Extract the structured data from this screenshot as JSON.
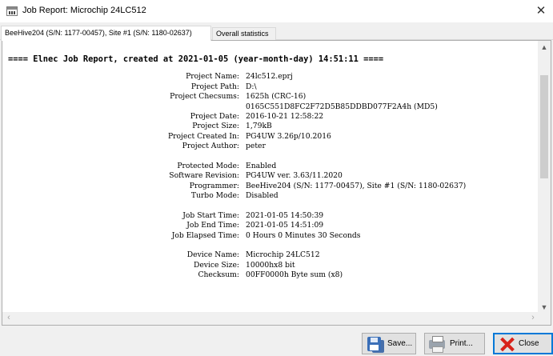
{
  "window": {
    "title": "Job Report: Microchip  24LC512",
    "app_icon": "elnec-app-icon",
    "close_glyph": "✕"
  },
  "tabs": [
    {
      "label": "BeeHive204 (S/N: 1177-00457), Site #1 (S/N: 1180-02637)",
      "active": true
    },
    {
      "label": "Overall statistics",
      "active": false
    }
  ],
  "report": {
    "title": "==== Elnec Job Report, created at 2021-01-05 (year-month-day)  14:51:11 ====",
    "project_section": [
      {
        "label": "Project Name:",
        "value": "24lc512.eprj"
      },
      {
        "label": "Project Path:",
        "value": "D:\\"
      },
      {
        "label": "Project Checsums:",
        "value": "1625h (CRC-16)"
      },
      {
        "label": "",
        "value": "0165C551D8FC2F72D5B85DDBD077F2A4h (MD5)"
      },
      {
        "label": "Project Date:",
        "value": "2016-10-21  12:58:22"
      },
      {
        "label": "Project Size:",
        "value": "1,79kB"
      },
      {
        "label": "Project Created In:",
        "value": "PG4UW 3.26p/10.2016"
      },
      {
        "label": "Project Author:",
        "value": "peter"
      }
    ],
    "mode_section": [
      {
        "label": "Protected Mode:",
        "value": "Enabled"
      },
      {
        "label": "Software Revision:",
        "value": "PG4UW ver. 3.63/11.2020"
      },
      {
        "label": "Programmer:",
        "value": "BeeHive204 (S/N: 1177-00457), Site #1 (S/N: 1180-02637)"
      },
      {
        "label": "Turbo Mode:",
        "value": "Disabled"
      }
    ],
    "time_section": [
      {
        "label": "Job Start Time:",
        "value": "2021-01-05  14:50:39"
      },
      {
        "label": "Job End Time:",
        "value": "2021-01-05  14:51:09"
      },
      {
        "label": "Job Elapsed Time:",
        "value": "0 Hours 0 Minutes 30 Seconds"
      }
    ],
    "device_section": [
      {
        "label": "Device Name:",
        "value": "Microchip  24LC512"
      },
      {
        "label": "Device Size:",
        "value": "10000hx8 bit"
      },
      {
        "label": "Checksum:",
        "value": "00FF0000h  Byte sum (x8)"
      }
    ]
  },
  "buttons": {
    "save": {
      "label": "Save...",
      "icon": "save-icon"
    },
    "print": {
      "label": "Print...",
      "icon": "printer-icon"
    },
    "close": {
      "label": "Close",
      "icon": "close-red-x-icon"
    }
  },
  "colors": {
    "window_bg": "#f0f0f0",
    "panel_bg": "#ffffff",
    "close_icon_red": "#d8221a",
    "default_button_border": "#0078d7"
  }
}
